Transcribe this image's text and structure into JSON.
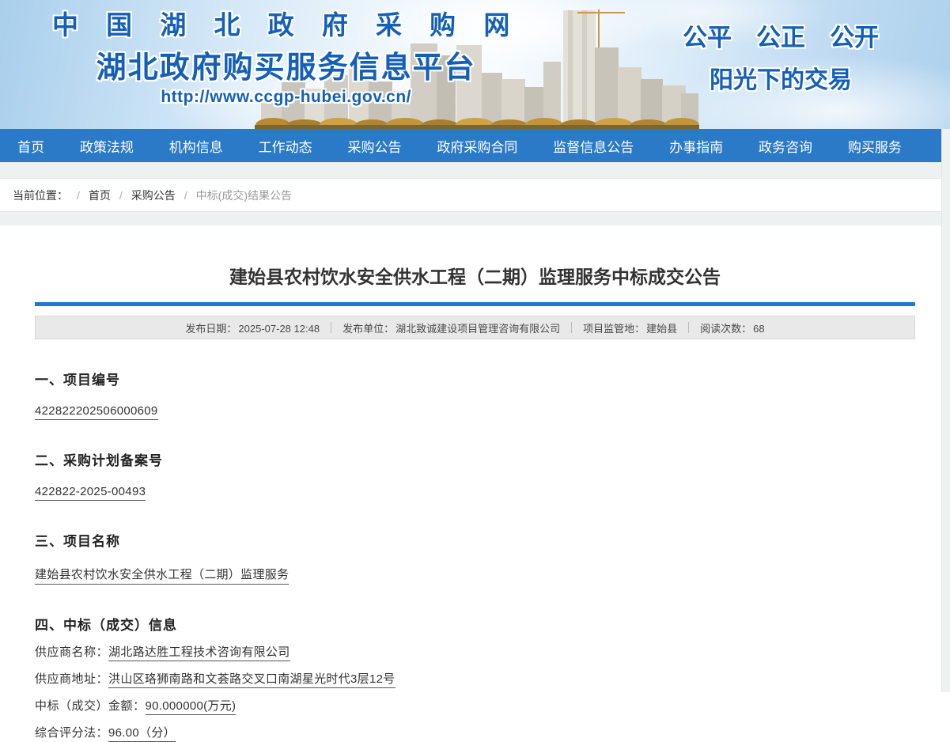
{
  "header": {
    "site_name_line1": "中 国 湖 北 政 府 采 购 网",
    "site_name_line2": "湖北政府购买服务信息平台",
    "site_url": "http://www.ccgp-hubei.gov.cn/",
    "slogan_line1": "公平　公正　公开",
    "slogan_line2": "阳光下的交易"
  },
  "nav": {
    "items": [
      "首页",
      "政策法规",
      "机构信息",
      "工作动态",
      "采购公告",
      "政府采购合同",
      "监督信息公告",
      "办事指南",
      "政务咨询",
      "购买服务"
    ]
  },
  "breadcrumb": {
    "label": "当前位置：",
    "separator": "/",
    "items": [
      "首页",
      "采购公告",
      "中标(成交)结果公告"
    ]
  },
  "article": {
    "title": "建始县农村饮水安全供水工程（二期）监理服务中标成交公告",
    "meta": [
      {
        "label": "发布日期：",
        "value": "2025-07-28 12:48"
      },
      {
        "label": "发布单位：",
        "value": "湖北致诚建设项目管理咨询有限公司"
      },
      {
        "label": "项目监管地：",
        "value": "建始县"
      },
      {
        "label": "阅读次数：",
        "value": "68"
      }
    ],
    "sections": [
      {
        "heading": "一、项目编号",
        "value": "422822202506000609"
      },
      {
        "heading": "二、采购计划备案号",
        "value": "422822-2025-00493"
      },
      {
        "heading": "三、项目名称",
        "value": "建始县农村饮水安全供水工程（二期）监理服务"
      },
      {
        "heading": "四、中标（成交）信息",
        "rows": [
          {
            "label": "供应商名称：",
            "value": "湖北路达胜工程技术咨询有限公司"
          },
          {
            "label": "供应商地址：",
            "value": "洪山区珞狮南路和文荟路交叉口南湖星光时代3层12号"
          },
          {
            "label": "中标（成交）金额：",
            "value": "90.000000(万元)"
          },
          {
            "label": "综合评分法：",
            "value": "96.00（分）"
          }
        ]
      }
    ]
  },
  "colors": {
    "nav_blue": "#2b7ac7",
    "rule_blue": "#1d79d2",
    "logo_blue": "#1460b8"
  }
}
